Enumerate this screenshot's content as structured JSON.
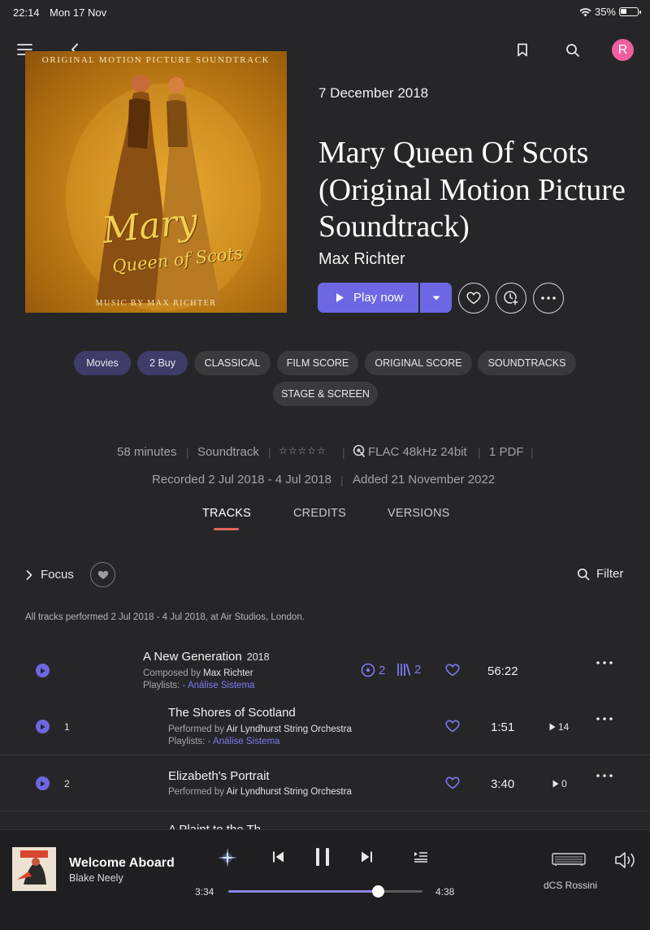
{
  "status_bar": {
    "time": "22:14",
    "date": "Mon 17 Nov",
    "battery": "35%"
  },
  "nav": {
    "avatar_letter": "R"
  },
  "cover": {
    "header_text": "ORIGINAL MOTION PICTURE SOUNDTRACK",
    "script_line1": "Mary",
    "script_line2": "Queen of Scots",
    "footer_text": "MUSIC BY MAX RICHTER"
  },
  "album": {
    "release_date": "7 December 2018",
    "title": "Mary Queen Of Scots (Original Motion Picture Soundtrack)",
    "artist": "Max Richter",
    "play_label": "Play now"
  },
  "tags": [
    "Movies",
    "2 Buy",
    "CLASSICAL",
    "FILM SCORE",
    "ORIGINAL SCORE",
    "SOUNDTRACKS",
    "STAGE & SCREEN"
  ],
  "meta": {
    "duration": "58 minutes",
    "genre": "Soundtrack",
    "rating_stars": "☆☆☆☆☆",
    "format": "FLAC 48kHz 24bit",
    "pdf": "1 PDF",
    "recorded": "Recorded 2 Jul 2018 - 4 Jul 2018",
    "added": "Added 21 November 2022"
  },
  "tabs": [
    "TRACKS",
    "CREDITS",
    "VERSIONS"
  ],
  "toolbar": {
    "focus_label": "Focus",
    "filter_label": "Filter"
  },
  "performed_note": "All tracks performed 2 Jul 2018 - 4 Jul 2018, at Air Studios, London.",
  "work": {
    "title": "A New Generation",
    "year": "2018",
    "composed_prefix": "Composed by",
    "composer": "Max Richter",
    "playlists_prefix": "Playlists:",
    "playlist": "- Análise Sistema",
    "disc_count": "2",
    "library_count": "2",
    "duration": "56:22"
  },
  "tracks": [
    {
      "number": "1",
      "title": "The Shores of Scotland",
      "performed_prefix": "Performed by",
      "performer": "Air Lyndhurst String Orchestra",
      "playlists_prefix": "Playlists:",
      "playlist": "- Análise Sistema",
      "duration": "1:51",
      "plays": "14"
    },
    {
      "number": "2",
      "title": "Elizabeth's Portrait",
      "performed_prefix": "Performed by",
      "performer": "Air Lyndhurst String Orchestra",
      "duration": "3:40",
      "plays": "0"
    },
    {
      "title_partial": "A Plaint to the Th"
    }
  ],
  "now_playing": {
    "title": "Welcome Aboard",
    "artist": "Blake Neely",
    "elapsed": "3:34",
    "total": "4:38",
    "progress": 0.77,
    "device": "dCS Rossini"
  },
  "colors": {
    "accent": "#6d67e4",
    "background": "#262629",
    "tab_underline": "#e0675c",
    "avatar": "#ef5fa0"
  }
}
